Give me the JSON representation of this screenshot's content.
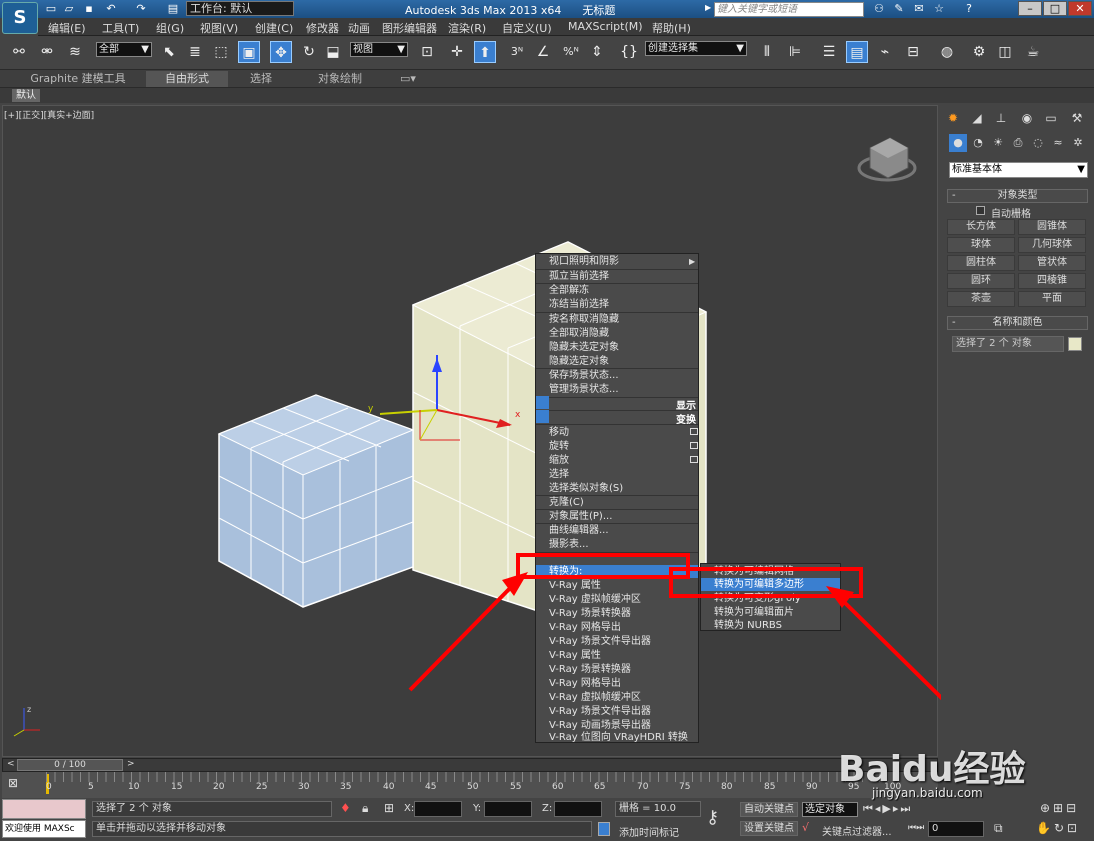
{
  "titlebar": {
    "workspace": "工作台: 默认",
    "app_title": "Autodesk 3ds Max  2013 x64",
    "doc_title": "无标题",
    "search_placeholder": "键入关键字或短语"
  },
  "menubar": {
    "items": [
      "编辑(E)",
      "工具(T)",
      "组(G)",
      "视图(V)",
      "创建(C)",
      "修改器",
      "动画",
      "图形编辑器",
      "渲染(R)",
      "自定义(U)",
      "MAXScript(M)",
      "帮助(H)"
    ]
  },
  "toolbar": {
    "selection_filter": "全部",
    "ref_coord": "视图",
    "selection_set": "创建选择集",
    "snap_3": "3",
    "snap_pct": "%"
  },
  "ribbon": {
    "tabs": [
      "Graphite 建模工具",
      "自由形式",
      "选择",
      "对象绘制"
    ],
    "default_label": "默认"
  },
  "viewport": {
    "label": "[+][正交][真实+边面]",
    "axis_y": "y",
    "axis_x": "x",
    "axis_z": "z"
  },
  "quad_menu": {
    "top": [
      "视口照明和阴影",
      "孤立当前选择",
      "全部解冻",
      "冻结当前选择",
      "按名称取消隐藏",
      "全部取消隐藏",
      "隐藏未选定对象",
      "隐藏选定对象",
      "保存场景状态...",
      "管理场景状态..."
    ],
    "display_header": "显示",
    "transform_header": "变换",
    "transform": [
      "移动",
      "旋转",
      "缩放",
      "选择",
      "选择类似对象(S)",
      "克隆(C)",
      "对象属性(P)...",
      "曲线编辑器...",
      "摄影表...",
      "转换为:",
      "V-Ray 属性",
      "V-Ray 虚拟帧缓冲区",
      "V-Ray 场景转换器",
      "V-Ray 网格导出",
      "V-Ray 场景文件导出器",
      "V-Ray 属性",
      "V-Ray 场景转换器",
      "V-Ray 网格导出",
      "V-Ray 虚拟帧缓冲区",
      "V-Ray 场景文件导出器",
      "V-Ray 动画场景导出器",
      "V-Ray 位图向 VRayHDRI 转换"
    ],
    "submenu": [
      "转换为可编辑网格",
      "转换为可编辑多边形",
      "转换为可变形gPoly",
      "转换为可编辑面片",
      "转换为 NURBS"
    ]
  },
  "command_panel": {
    "category": "标准基本体",
    "object_type_header": "对象类型",
    "autogrid": "自动栅格",
    "objects": [
      "长方体",
      "圆锥体",
      "球体",
      "几何球体",
      "圆柱体",
      "管状体",
      "圆环",
      "四棱锥",
      "茶壶",
      "平面"
    ],
    "name_color_header": "名称和颜色",
    "name_value": "选择了 2 个 对象",
    "selected_color": "#e8e8c8"
  },
  "timeline": {
    "frame": "0 / 100",
    "ticks": [
      "0",
      "5",
      "10",
      "15",
      "20",
      "25",
      "30",
      "35",
      "40",
      "45",
      "50",
      "55",
      "60",
      "65",
      "70",
      "75",
      "80",
      "85",
      "90",
      "95",
      "100"
    ]
  },
  "statusbar": {
    "maxscript": "欢迎使用 MAXSc",
    "status1": "选择了 2 个 对象",
    "status2": "单击并拖动以选择并移动对象",
    "x_label": "X:",
    "y_label": "Y:",
    "z_label": "Z:",
    "grid": "栅格 = 10.0",
    "add_time_tag": "添加时间标记",
    "auto_key": "自动关键点",
    "selected": "选定对象",
    "set_key": "设置关键点",
    "key_filters": "关键点过滤器...",
    "frame_field": "0"
  },
  "watermark": {
    "brand": "Baidu经验",
    "url": "jingyan.baidu.com"
  },
  "colors": {
    "highlight": "#3a7fd0",
    "annotation": "#ff0000",
    "cube_blue": "#a9c0dc",
    "cube_cream": "#e4e4c6"
  }
}
